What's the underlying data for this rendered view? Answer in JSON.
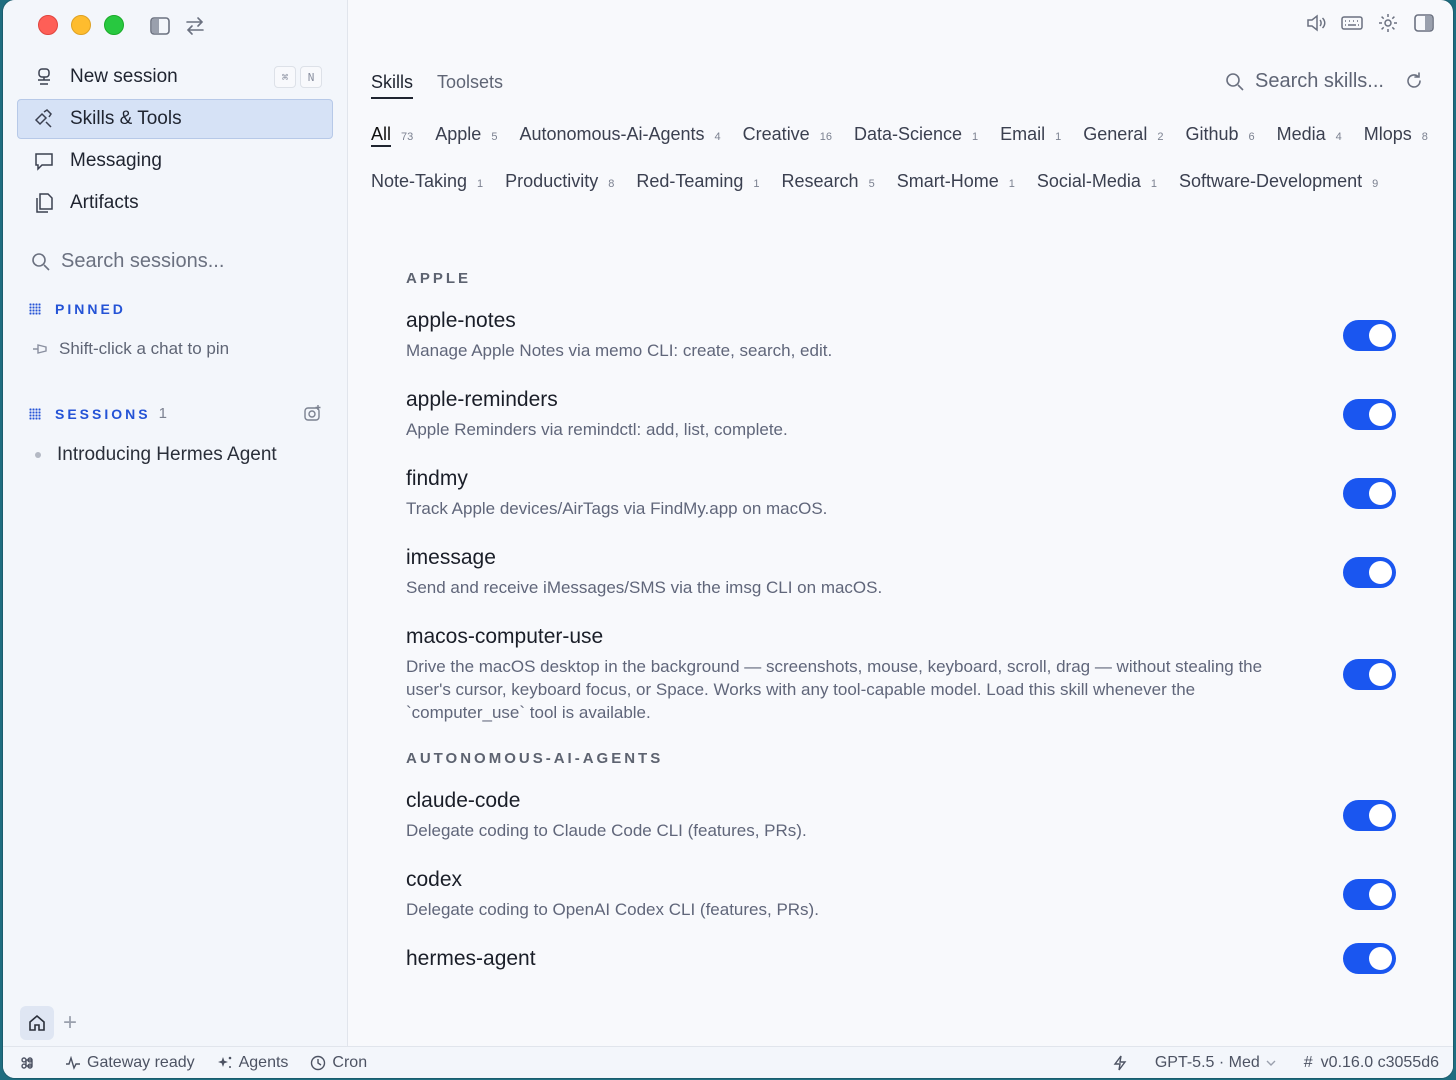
{
  "sidebar": {
    "nav": [
      {
        "label": "New session",
        "shortcut": [
          "⌘",
          "N"
        ]
      },
      {
        "label": "Skills & Tools"
      },
      {
        "label": "Messaging"
      },
      {
        "label": "Artifacts"
      }
    ],
    "search_placeholder": "Search sessions...",
    "pinned": {
      "title": "PINNED",
      "hint": "Shift-click a chat to pin"
    },
    "sessions": {
      "title": "SESSIONS",
      "count": "1",
      "items": [
        "Introducing Hermes Agent"
      ]
    }
  },
  "statusbar": {
    "left": [
      {
        "label": "Gateway ready"
      },
      {
        "label": "Agents"
      },
      {
        "label": "Cron"
      }
    ],
    "model": "GPT-5.5 · Med",
    "version": "v0.16.0 c3055d6"
  },
  "main": {
    "tabs": [
      "Skills",
      "Toolsets"
    ],
    "search_placeholder": "Search skills...",
    "filters": [
      {
        "label": "All",
        "count": "73"
      },
      {
        "label": "Apple",
        "count": "5"
      },
      {
        "label": "Autonomous-Ai-Agents",
        "count": "4"
      },
      {
        "label": "Creative",
        "count": "16"
      },
      {
        "label": "Data-Science",
        "count": "1"
      },
      {
        "label": "Email",
        "count": "1"
      },
      {
        "label": "General",
        "count": "2"
      },
      {
        "label": "Github",
        "count": "6"
      },
      {
        "label": "Media",
        "count": "4"
      },
      {
        "label": "Mlops",
        "count": "8"
      },
      {
        "label": "Note-Taking",
        "count": "1"
      },
      {
        "label": "Productivity",
        "count": "8"
      },
      {
        "label": "Red-Teaming",
        "count": "1"
      },
      {
        "label": "Research",
        "count": "5"
      },
      {
        "label": "Smart-Home",
        "count": "1"
      },
      {
        "label": "Social-Media",
        "count": "1"
      },
      {
        "label": "Software-Development",
        "count": "9"
      }
    ],
    "categories": [
      {
        "title": "APPLE",
        "skills": [
          {
            "name": "apple-notes",
            "desc": "Manage Apple Notes via memo CLI: create, search, edit.",
            "enabled": true
          },
          {
            "name": "apple-reminders",
            "desc": "Apple Reminders via remindctl: add, list, complete.",
            "enabled": true
          },
          {
            "name": "findmy",
            "desc": "Track Apple devices/AirTags via FindMy.app on macOS.",
            "enabled": true
          },
          {
            "name": "imessage",
            "desc": "Send and receive iMessages/SMS via the imsg CLI on macOS.",
            "enabled": true
          },
          {
            "name": "macos-computer-use",
            "desc": "Drive the macOS desktop in the background — screenshots, mouse, keyboard, scroll, drag — without stealing the user's cursor, keyboard focus, or Space. Works with any tool-capable model. Load this skill whenever the `computer_use` tool is available.",
            "enabled": true
          }
        ]
      },
      {
        "title": "AUTONOMOUS-AI-AGENTS",
        "skills": [
          {
            "name": "claude-code",
            "desc": "Delegate coding to Claude Code CLI (features, PRs).",
            "enabled": true
          },
          {
            "name": "codex",
            "desc": "Delegate coding to OpenAI Codex CLI (features, PRs).",
            "enabled": true
          },
          {
            "name": "hermes-agent",
            "desc": "",
            "enabled": true
          }
        ]
      }
    ]
  },
  "colors": {
    "accent": "#1a56f0",
    "section": "#2453d6",
    "active_nav": "#d6e2f6"
  }
}
